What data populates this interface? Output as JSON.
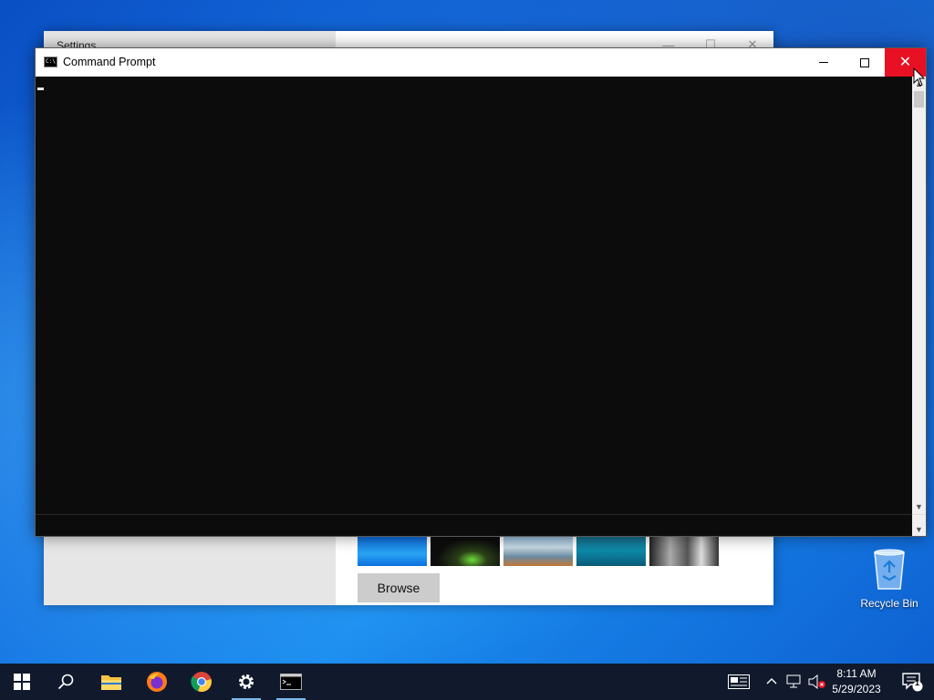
{
  "settings_window": {
    "title": "Settings",
    "browse_label": "Browse"
  },
  "cmd_window": {
    "title": "Command Prompt",
    "icon_text": "C:\\",
    "minimize": "minimize",
    "maximize": "maximize",
    "close": "✕"
  },
  "desktop": {
    "recycle_bin_label": "Recycle Bin"
  },
  "taskbar": {
    "time": "8:11 AM",
    "date": "5/29/2023",
    "notification_count": "1",
    "items": [
      "start-icon",
      "search-icon",
      "file-explorer-icon",
      "firefox-icon",
      "chrome-icon",
      "settings-icon",
      "command-prompt-icon"
    ]
  },
  "colors": {
    "close_red": "#e81123",
    "console_bg": "#0c0c0c",
    "taskbar_bg": "#101a2c",
    "active_indicator": "#76b9ed"
  }
}
